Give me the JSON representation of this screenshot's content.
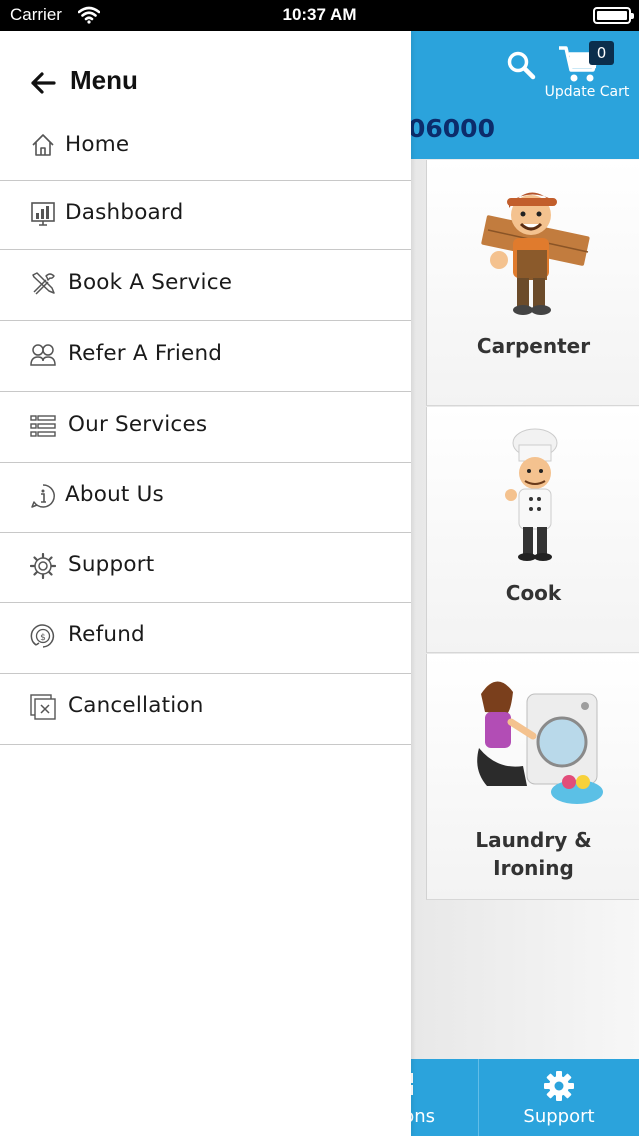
{
  "status_bar": {
    "carrier": "Carrier",
    "time": "10:37 AM"
  },
  "header": {
    "cart_count": "0",
    "cart_label": "Update Cart",
    "phone_partial": "06000",
    "background_color": "#2ba3dc"
  },
  "services": [
    {
      "name": "Carpenter",
      "icon": "carpenter-illustration"
    },
    {
      "name": "Cook",
      "icon": "chef-illustration"
    },
    {
      "name": "Laundry &\nIroning",
      "icon": "laundry-illustration"
    }
  ],
  "bottom_nav": {
    "partial_label": "ons",
    "support_label": "Support"
  },
  "drawer": {
    "title": "Menu",
    "items": [
      {
        "label": "Home",
        "icon": "home-icon"
      },
      {
        "label": "Dashboard",
        "icon": "dashboard-icon"
      },
      {
        "label": "Book A Service",
        "icon": "tools-icon"
      },
      {
        "label": "Refer A Friend",
        "icon": "friends-icon"
      },
      {
        "label": "Our Services",
        "icon": "list-icon"
      },
      {
        "label": "About Us",
        "icon": "info-icon"
      },
      {
        "label": "Support",
        "icon": "gear-icon"
      },
      {
        "label": "Refund",
        "icon": "refund-icon"
      },
      {
        "label": "Cancellation",
        "icon": "cancel-icon"
      }
    ]
  }
}
